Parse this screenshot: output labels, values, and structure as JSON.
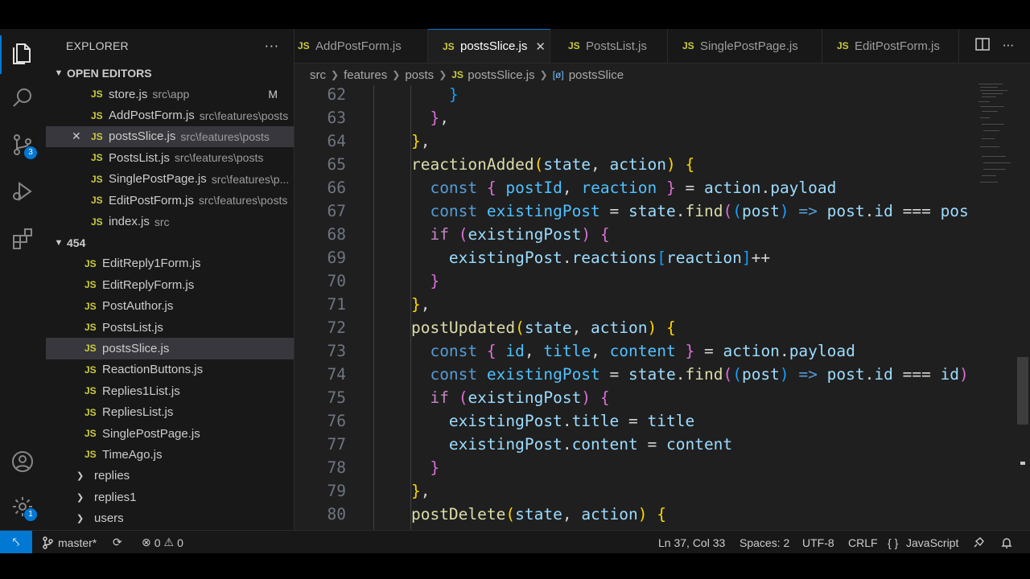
{
  "activity_bar": {
    "icons": [
      "files-icon",
      "search-icon",
      "source-control-icon",
      "run-debug-icon",
      "extensions-icon",
      "account-icon",
      "settings-gear-icon"
    ],
    "source_control_badge": "3",
    "settings_badge": "1",
    "accent_color": "#0078d4"
  },
  "sidebar": {
    "title": "EXPLORER",
    "more": "···",
    "open_editors_label": "OPEN EDITORS",
    "open_editors": [
      {
        "name": "store.js",
        "path": "src\\app",
        "status": "M"
      },
      {
        "name": "AddPostForm.js",
        "path": "src\\features\\posts",
        "status": ""
      },
      {
        "name": "postsSlice.js",
        "path": "src\\features\\posts",
        "status": ""
      },
      {
        "name": "PostsList.js",
        "path": "src\\features\\posts",
        "status": ""
      },
      {
        "name": "SinglePostPage.js",
        "path": "src\\features\\p...",
        "status": ""
      },
      {
        "name": "EditPostForm.js",
        "path": "src\\features\\posts",
        "status": ""
      },
      {
        "name": "index.js",
        "path": "src",
        "status": ""
      }
    ],
    "folder_label": "454",
    "files": [
      "EditReply1Form.js",
      "EditReplyForm.js",
      "PostAuthor.js",
      "PostsList.js",
      "postsSlice.js",
      "ReactionButtons.js",
      "Replies1List.js",
      "RepliesList.js",
      "SinglePostPage.js",
      "TimeAgo.js"
    ],
    "folders": [
      "replies",
      "replies1",
      "users"
    ]
  },
  "tabs": [
    {
      "label": "AddPostForm.js",
      "active": false
    },
    {
      "label": "postsSlice.js",
      "active": true
    },
    {
      "label": "PostsList.js",
      "active": false
    },
    {
      "label": "SinglePostPage.js",
      "active": false
    },
    {
      "label": "EditPostForm.js",
      "active": false
    }
  ],
  "tab_actions": {
    "split": "split-editor-icon",
    "more": "···"
  },
  "breadcrumb": [
    "src",
    "features",
    "posts",
    "postsSlice.js",
    "postsSlice"
  ],
  "editor": {
    "line_numbers": [
      "62",
      "63",
      "64",
      "65",
      "66",
      "67",
      "68",
      "69",
      "70",
      "71",
      "72",
      "73",
      "74",
      "75",
      "76",
      "77",
      "78",
      "79",
      "80"
    ]
  },
  "status_bar": {
    "branch": "master*",
    "errors": "0",
    "warnings": "0",
    "position": "Ln 37, Col 33",
    "spaces": "Spaces: 2",
    "encoding": "UTF-8",
    "eol": "CRLF",
    "braces": "{ }",
    "language": "JavaScript"
  }
}
